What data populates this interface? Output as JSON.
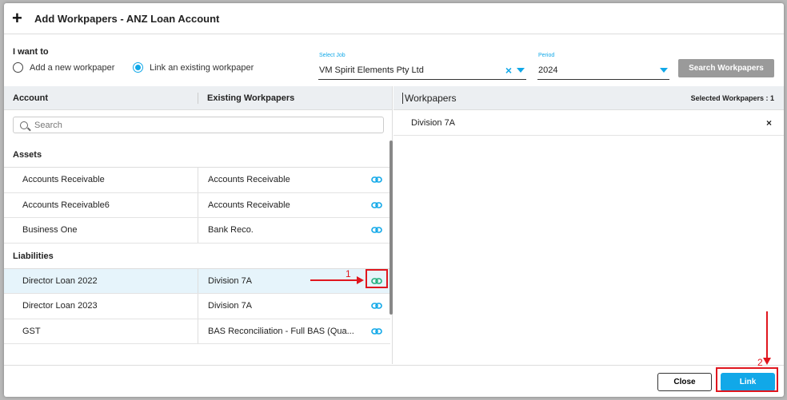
{
  "dialog": {
    "title": "Add Workpapers - ANZ Loan Account"
  },
  "mode": {
    "label": "I want to",
    "option_new": "Add a new workpaper",
    "option_link": "Link an existing workpaper",
    "selected": "link"
  },
  "job": {
    "label": "Select Job",
    "value": "VM Spirit Elements Pty Ltd"
  },
  "period": {
    "label": "Period",
    "value": "2024"
  },
  "search_workpapers_label": "Search Workpapers",
  "left": {
    "col_account": "Account",
    "col_existing": "Existing Workpapers",
    "search_placeholder": "Search",
    "groups": [
      {
        "name": "Assets",
        "rows": [
          {
            "account": "Accounts Receivable",
            "workpaper": "Accounts Receivable"
          },
          {
            "account": "Accounts Receivable6",
            "workpaper": "Accounts Receivable"
          },
          {
            "account": "Business One",
            "workpaper": "Bank Reco."
          }
        ]
      },
      {
        "name": "Liabilities",
        "rows": [
          {
            "account": "Director Loan 2022",
            "workpaper": "Division 7A",
            "selected": true
          },
          {
            "account": "Director Loan 2023",
            "workpaper": "Division 7A"
          },
          {
            "account": "GST",
            "workpaper": "BAS Reconciliation - Full BAS (Qua..."
          }
        ]
      }
    ]
  },
  "right": {
    "title": "Workpapers",
    "selected_count": "Selected Workpapers : 1",
    "selected_items": [
      "Division 7A"
    ]
  },
  "footer": {
    "close_label": "Close",
    "link_label": "Link"
  },
  "annotations": {
    "step1": "1",
    "step2": "2"
  },
  "colors": {
    "accent": "#11a8e8",
    "annotation": "#e0161e"
  }
}
